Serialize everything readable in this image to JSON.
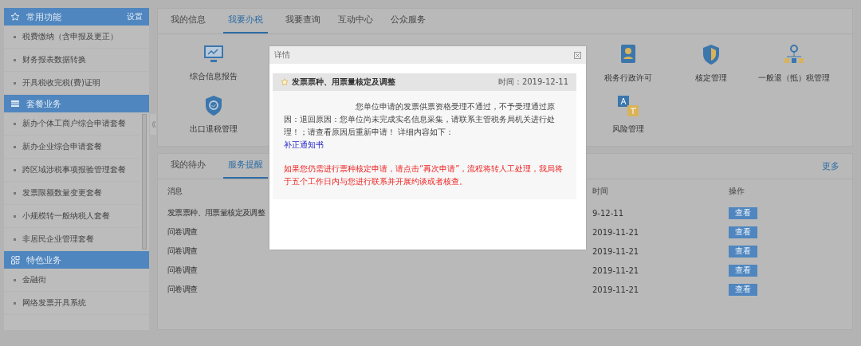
{
  "sidebar": {
    "sections": [
      {
        "title": "常用功能",
        "action": "设置",
        "items": [
          "税费缴纳（含申报及更正）",
          "财务报表数据转换",
          "开具税收完税(费)证明"
        ]
      },
      {
        "title": "套餐业务",
        "items": [
          "新办个体工商户综合申请套餐",
          "新办企业综合申请套餐",
          "跨区域涉税事项报验管理套餐",
          "发票限额数量变更套餐",
          "小规模转一般纳税人套餐",
          "非居民企业管理套餐"
        ]
      },
      {
        "title": "特色业务",
        "items": [
          "金融街",
          "网络发票开具系统"
        ]
      }
    ]
  },
  "main_tabs": [
    {
      "label": "我的信息",
      "selected": false
    },
    {
      "label": "我要办税",
      "selected": true
    },
    {
      "label": "我要查询",
      "selected": false
    },
    {
      "label": "互动中心",
      "selected": false
    },
    {
      "label": "公众服务",
      "selected": false
    }
  ],
  "services": [
    [
      "综合信息报告",
      "税务行政许可",
      "核定管理",
      "一般退（抵）税管理"
    ],
    [
      "出口退税管理",
      "风险管理"
    ]
  ],
  "lower_tabs": [
    {
      "label": "我的待办",
      "selected": false
    },
    {
      "label": "服务提醒",
      "selected": true
    }
  ],
  "more_link": "更多",
  "table": {
    "columns": [
      "消息",
      "时间",
      "操作"
    ],
    "rows": [
      {
        "message": "发票票种、用票量核定及调整",
        "time": "9-12-11",
        "action": "查看"
      },
      {
        "message": "问卷调查",
        "time": "2019-11-21",
        "action": "查看"
      },
      {
        "message": "问卷调查",
        "time": "2019-11-21",
        "action": "查看"
      },
      {
        "message": "问卷调查",
        "time": "2019-11-21",
        "action": "查看"
      },
      {
        "message": "问卷调查",
        "time": "2019-11-21",
        "action": "查看"
      }
    ]
  },
  "dialog": {
    "title": "详情",
    "notice": {
      "title": "发票票种、用票量核定及调整",
      "time": "时间：2019-12-11",
      "body": "您单位申请的发票供票资格受理不通过，不予受理通过原因：退回原因：您单位尚未完成实名信息采集，请联系主管税务局机关进行处理！；请查看原因后重新申请！ 详细内容如下：",
      "link": "补正通知书",
      "warning": "如果您仍需进行票种核定申请，请点击“再次申请”，流程将转人工处理，我局将于五个工作日内与您进行联系并开展约谈或者核查。"
    }
  }
}
